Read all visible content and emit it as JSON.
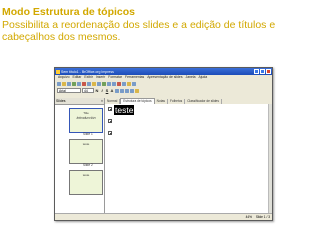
{
  "caption": {
    "title": "Modo Estrutura de tópicos",
    "description": "Possibilita a reordenação dos slides e a edição de títulos e cabeçalhos dos mesmos."
  },
  "window": {
    "title": "Sem título1 - BrOffice.org Impress",
    "menu": [
      "Arquivo",
      "Editar",
      "Exibir",
      "Inserir",
      "Formatar",
      "Ferramentas",
      "Apresentação de slides",
      "Janela",
      "Ajuda"
    ],
    "font_name": "Arial",
    "font_size": "44",
    "format_buttons": [
      "N",
      "I",
      "S",
      "A"
    ]
  },
  "slides_panel": {
    "title": "Slides",
    "close": "×",
    "slides": [
      {
        "line1": "Title",
        "line2": "Introducción",
        "label": "Slide 1"
      },
      {
        "line1": "teste",
        "line2": "",
        "label": "Slide 2"
      },
      {
        "line1": "teste",
        "line2": "",
        "label": "Slide 3"
      }
    ]
  },
  "tabs": [
    "Normal",
    "Estrutura de tópicos",
    "Notas",
    "Folhetos",
    "Classificador de slides"
  ],
  "outline": {
    "first_title": "teste"
  },
  "status": {
    "zoom": "44%",
    "page": "Slide 1 / 3"
  },
  "colors": {
    "caption": "#d2a800",
    "titlebar": "#1c4cb8",
    "thumbnail_bg": "#eef5d8"
  }
}
